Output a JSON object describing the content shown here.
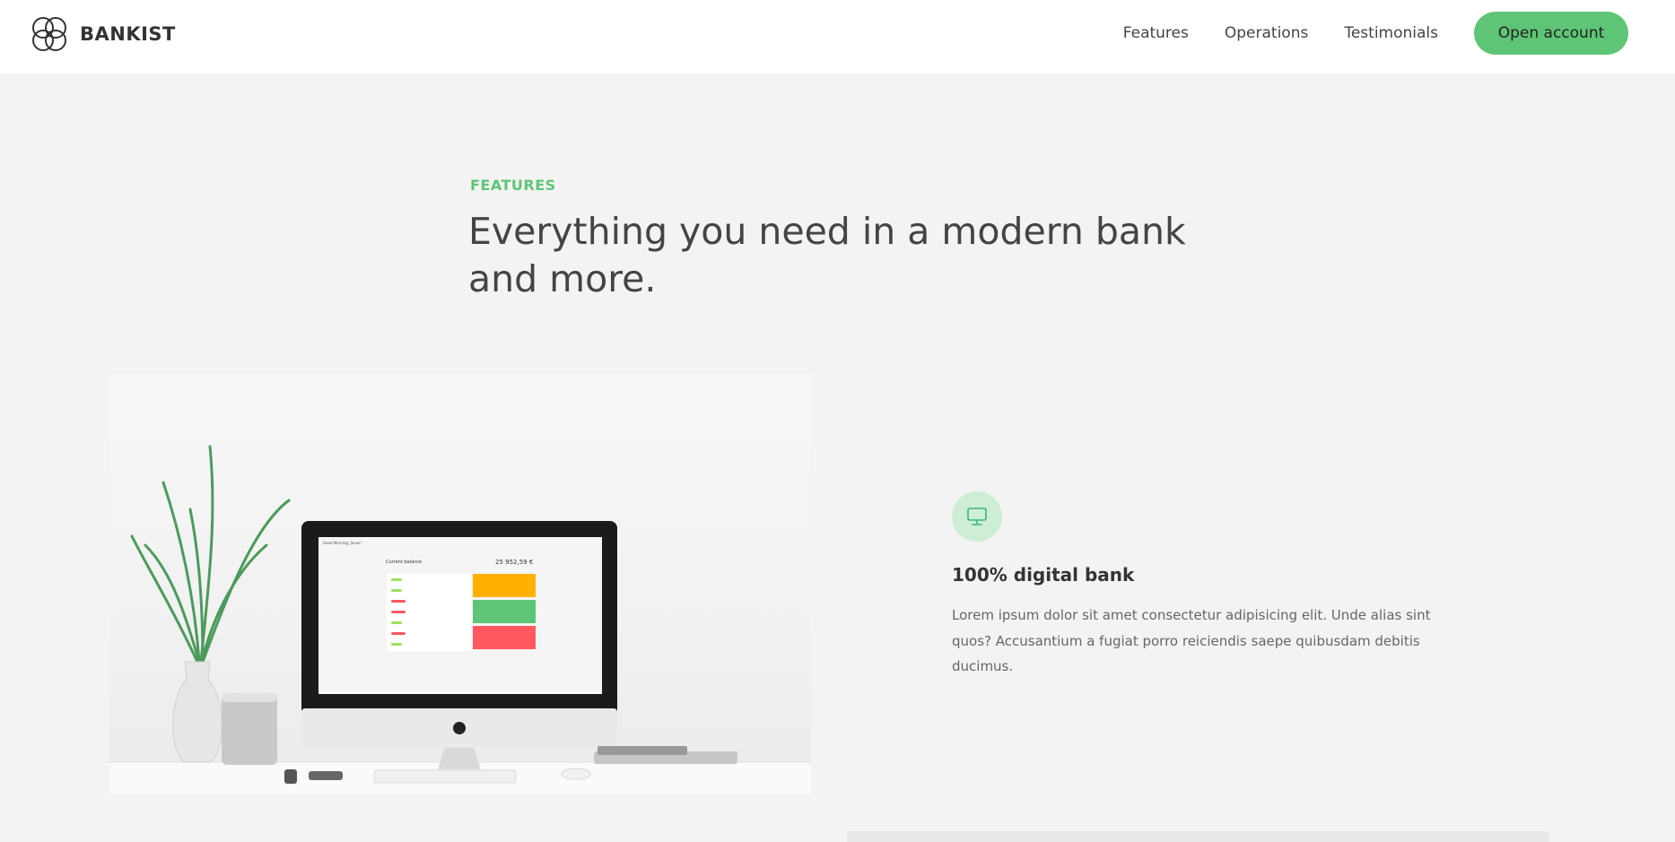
{
  "brand": {
    "name": "BANKIST",
    "logo_icon": "four-circles-logo"
  },
  "nav": {
    "links": [
      "Features",
      "Operations",
      "Testimonials"
    ],
    "cta": "Open account"
  },
  "section": {
    "label": "FEATURES",
    "heading_line1": "Everything you need in a modern bank",
    "heading_line2": "and more."
  },
  "screen": {
    "greeting": "Good Morning, Jonas!",
    "balance_label": "Current balance",
    "balance": "25 952,59 €"
  },
  "feature": {
    "icon": "monitor-icon",
    "title": "100% digital bank",
    "text": "Lorem ipsum dolor sit amet consectetur adipisicing elit. Unde alias sint quos? Accusantium a fugiat porro reiciendis saepe quibusdam debitis ducimus."
  },
  "colors": {
    "accent": "#5ec576",
    "accent_light": "#cdeed4",
    "background": "#f3f3f3",
    "card_yellow": "#ffb003",
    "card_green": "#5ec576",
    "card_red": "#ff585f"
  }
}
